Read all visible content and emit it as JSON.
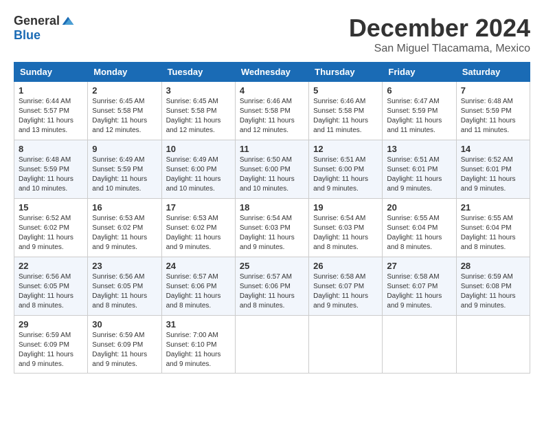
{
  "header": {
    "logo_general": "General",
    "logo_blue": "Blue",
    "month": "December 2024",
    "location": "San Miguel Tlacamama, Mexico"
  },
  "days_of_week": [
    "Sunday",
    "Monday",
    "Tuesday",
    "Wednesday",
    "Thursday",
    "Friday",
    "Saturday"
  ],
  "weeks": [
    [
      {
        "day": 1,
        "sunrise": "6:44 AM",
        "sunset": "5:57 PM",
        "daylight": "11 hours and 13 minutes."
      },
      {
        "day": 2,
        "sunrise": "6:45 AM",
        "sunset": "5:58 PM",
        "daylight": "11 hours and 12 minutes."
      },
      {
        "day": 3,
        "sunrise": "6:45 AM",
        "sunset": "5:58 PM",
        "daylight": "11 hours and 12 minutes."
      },
      {
        "day": 4,
        "sunrise": "6:46 AM",
        "sunset": "5:58 PM",
        "daylight": "11 hours and 12 minutes."
      },
      {
        "day": 5,
        "sunrise": "6:46 AM",
        "sunset": "5:58 PM",
        "daylight": "11 hours and 11 minutes."
      },
      {
        "day": 6,
        "sunrise": "6:47 AM",
        "sunset": "5:59 PM",
        "daylight": "11 hours and 11 minutes."
      },
      {
        "day": 7,
        "sunrise": "6:48 AM",
        "sunset": "5:59 PM",
        "daylight": "11 hours and 11 minutes."
      }
    ],
    [
      {
        "day": 8,
        "sunrise": "6:48 AM",
        "sunset": "5:59 PM",
        "daylight": "11 hours and 10 minutes."
      },
      {
        "day": 9,
        "sunrise": "6:49 AM",
        "sunset": "5:59 PM",
        "daylight": "11 hours and 10 minutes."
      },
      {
        "day": 10,
        "sunrise": "6:49 AM",
        "sunset": "6:00 PM",
        "daylight": "11 hours and 10 minutes."
      },
      {
        "day": 11,
        "sunrise": "6:50 AM",
        "sunset": "6:00 PM",
        "daylight": "11 hours and 10 minutes."
      },
      {
        "day": 12,
        "sunrise": "6:51 AM",
        "sunset": "6:00 PM",
        "daylight": "11 hours and 9 minutes."
      },
      {
        "day": 13,
        "sunrise": "6:51 AM",
        "sunset": "6:01 PM",
        "daylight": "11 hours and 9 minutes."
      },
      {
        "day": 14,
        "sunrise": "6:52 AM",
        "sunset": "6:01 PM",
        "daylight": "11 hours and 9 minutes."
      }
    ],
    [
      {
        "day": 15,
        "sunrise": "6:52 AM",
        "sunset": "6:02 PM",
        "daylight": "11 hours and 9 minutes."
      },
      {
        "day": 16,
        "sunrise": "6:53 AM",
        "sunset": "6:02 PM",
        "daylight": "11 hours and 9 minutes."
      },
      {
        "day": 17,
        "sunrise": "6:53 AM",
        "sunset": "6:02 PM",
        "daylight": "11 hours and 9 minutes."
      },
      {
        "day": 18,
        "sunrise": "6:54 AM",
        "sunset": "6:03 PM",
        "daylight": "11 hours and 9 minutes."
      },
      {
        "day": 19,
        "sunrise": "6:54 AM",
        "sunset": "6:03 PM",
        "daylight": "11 hours and 8 minutes."
      },
      {
        "day": 20,
        "sunrise": "6:55 AM",
        "sunset": "6:04 PM",
        "daylight": "11 hours and 8 minutes."
      },
      {
        "day": 21,
        "sunrise": "6:55 AM",
        "sunset": "6:04 PM",
        "daylight": "11 hours and 8 minutes."
      }
    ],
    [
      {
        "day": 22,
        "sunrise": "6:56 AM",
        "sunset": "6:05 PM",
        "daylight": "11 hours and 8 minutes."
      },
      {
        "day": 23,
        "sunrise": "6:56 AM",
        "sunset": "6:05 PM",
        "daylight": "11 hours and 8 minutes."
      },
      {
        "day": 24,
        "sunrise": "6:57 AM",
        "sunset": "6:06 PM",
        "daylight": "11 hours and 8 minutes."
      },
      {
        "day": 25,
        "sunrise": "6:57 AM",
        "sunset": "6:06 PM",
        "daylight": "11 hours and 8 minutes."
      },
      {
        "day": 26,
        "sunrise": "6:58 AM",
        "sunset": "6:07 PM",
        "daylight": "11 hours and 9 minutes."
      },
      {
        "day": 27,
        "sunrise": "6:58 AM",
        "sunset": "6:07 PM",
        "daylight": "11 hours and 9 minutes."
      },
      {
        "day": 28,
        "sunrise": "6:59 AM",
        "sunset": "6:08 PM",
        "daylight": "11 hours and 9 minutes."
      }
    ],
    [
      {
        "day": 29,
        "sunrise": "6:59 AM",
        "sunset": "6:09 PM",
        "daylight": "11 hours and 9 minutes."
      },
      {
        "day": 30,
        "sunrise": "6:59 AM",
        "sunset": "6:09 PM",
        "daylight": "11 hours and 9 minutes."
      },
      {
        "day": 31,
        "sunrise": "7:00 AM",
        "sunset": "6:10 PM",
        "daylight": "11 hours and 9 minutes."
      },
      null,
      null,
      null,
      null
    ]
  ]
}
